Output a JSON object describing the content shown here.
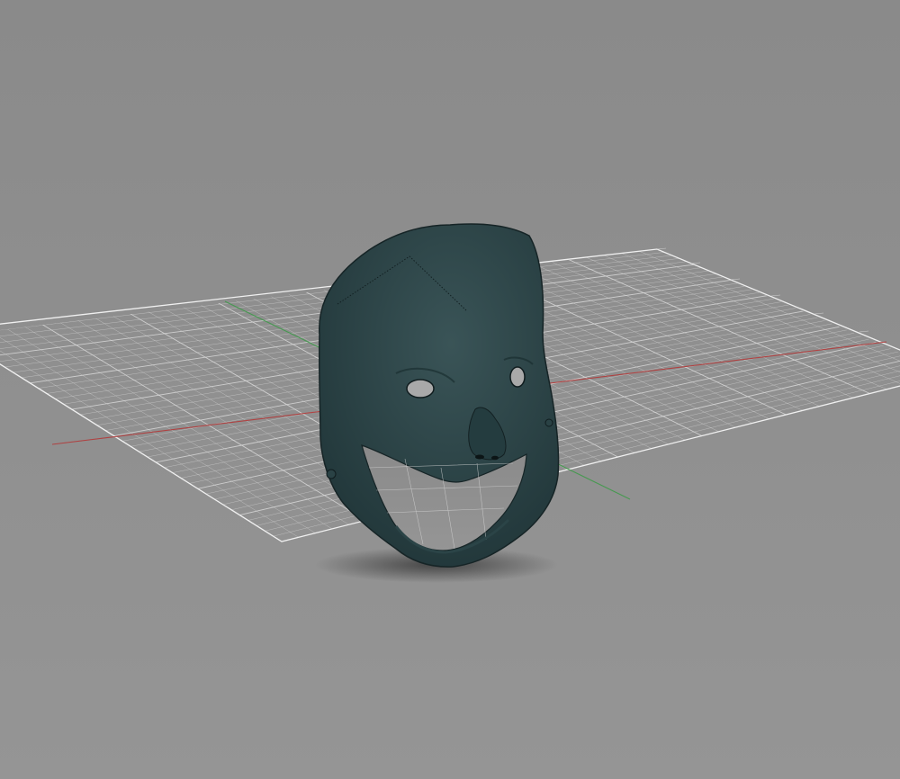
{
  "scene": {
    "background_top": "#8a8a8a",
    "background_bottom": "#959595",
    "grid_line_color": "#d9d9d9",
    "grid_border_color": "#f0f0f0",
    "x_axis_color": "#b23a3a",
    "y_axis_color": "#3f9a4a",
    "model_color": "#1f3437",
    "model_highlight": "#3a5457",
    "shadow_color": "#2d2d2d"
  },
  "model": {
    "icon": "face-mask-model"
  }
}
